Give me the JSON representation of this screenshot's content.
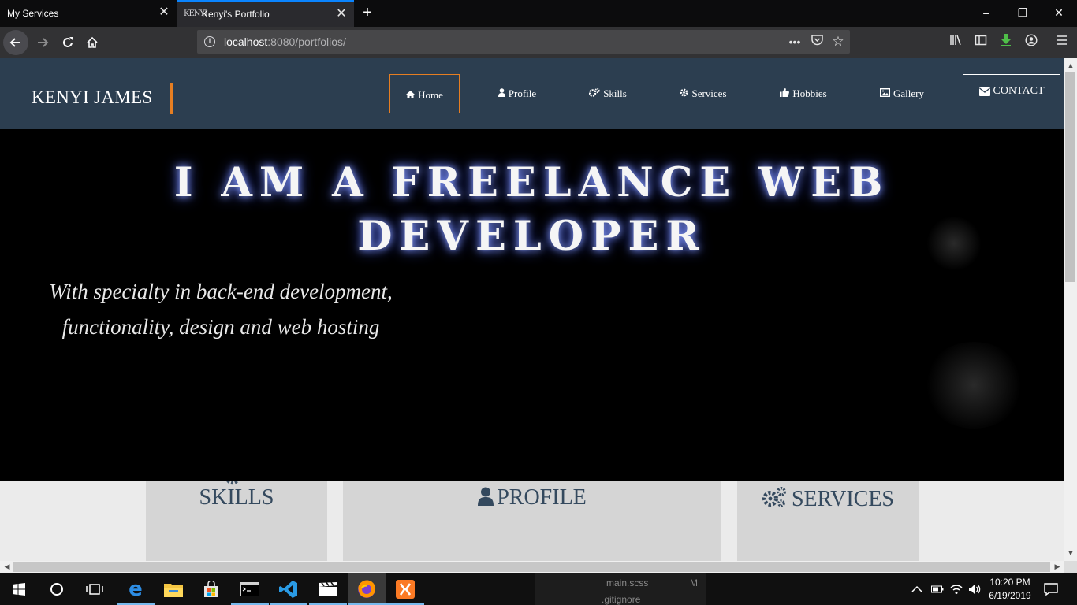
{
  "browser": {
    "tabs": [
      {
        "title": "My Services",
        "active": false
      },
      {
        "title": "Kenyi's Portfolio",
        "active": true
      }
    ],
    "url_host": "localhost",
    "url_rest": ":8080/portfolios/",
    "accent": "#0a84ff"
  },
  "site": {
    "brand": "KENYI JAMES",
    "brand_accent": "#e67e22",
    "header_bg": "#2c3e50",
    "menu": [
      {
        "label": "Home",
        "icon": "home-icon",
        "selected": true
      },
      {
        "label": "Profile",
        "icon": "user-icon"
      },
      {
        "label": "Skills",
        "icon": "cogs-icon"
      },
      {
        "label": "Services",
        "icon": "cog-icon"
      },
      {
        "label": "Hobbies",
        "icon": "thumbs-up-icon"
      },
      {
        "label": "Gallery",
        "icon": "image-icon"
      }
    ],
    "contact_label": "CONTACT",
    "hero_title": "I AM A FREELANCE WEB DEVELOPER",
    "hero_sub_line1": "With specialty in back-end development,",
    "hero_sub_line2": "functionality, design and web hosting",
    "cards": [
      {
        "title": "SKILLS",
        "icon": "cogs-icon"
      },
      {
        "title": "PROFILE",
        "icon": "user-icon"
      },
      {
        "title": "SERVICES",
        "icon": "cogs-icon"
      }
    ]
  },
  "taskbar": {
    "peek_line1": "main.scss",
    "peek_badge": "M",
    "peek_line2": ".gitignore",
    "time": "10:20 PM",
    "date": "6/19/2019"
  }
}
